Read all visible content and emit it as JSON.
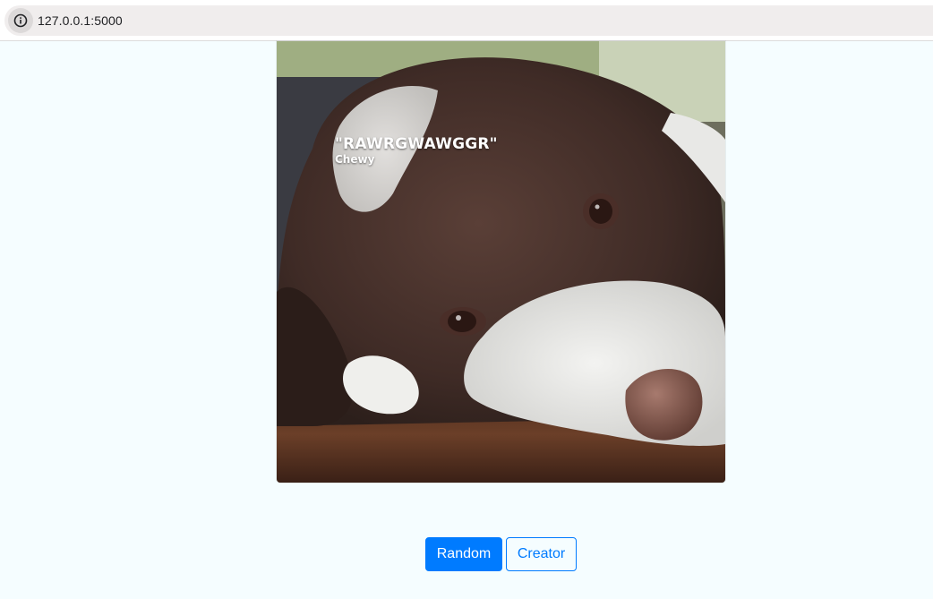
{
  "browser": {
    "url": "127.0.0.1:5000",
    "info_icon": "info-icon"
  },
  "card": {
    "image_subject": "brown-and-white-spaniel-dog",
    "quote": "\"RAWRGWAWGGR\"",
    "author": "Chewy"
  },
  "buttons": {
    "random_label": "Random",
    "creator_label": "Creator"
  },
  "colors": {
    "page_background": "#f5fdff",
    "accent": "#007bff",
    "address_bar": "#f0eded"
  }
}
